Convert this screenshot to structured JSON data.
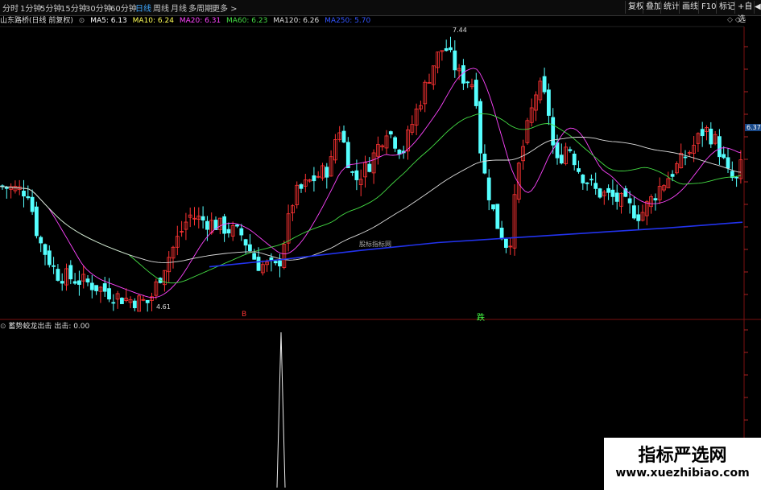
{
  "toolbar": {
    "tabs": [
      "分时",
      "1分钟",
      "5分钟",
      "15分钟",
      "30分钟",
      "60分钟",
      "日线",
      "周线",
      "月线",
      "多周期",
      "更多 >"
    ],
    "active_tab": "日线",
    "right_buttons": [
      "复权",
      "叠加",
      "统计",
      "画线",
      "F10",
      "标记",
      "+自选",
      "◀"
    ]
  },
  "stock": {
    "name": "山东路桥(日线 前复权)"
  },
  "ma_legend": [
    {
      "label": "MA5: 6.13",
      "color": "#ffffff"
    },
    {
      "label": "MA10: 6.24",
      "color": "#ffff55"
    },
    {
      "label": "MA20: 6.31",
      "color": "#ff44ff"
    },
    {
      "label": "MA60: 6.23",
      "color": "#44dd44"
    },
    {
      "label": "MA120: 6.26",
      "color": "#dddddd"
    },
    {
      "label": "MA250: 5.70",
      "color": "#3355ff"
    }
  ],
  "annotations": {
    "high": "7.44",
    "low": "4.61",
    "last_price": "6.37",
    "center_watermark": "股标指标网",
    "buy_marker": "B",
    "sell_marker": "跌"
  },
  "colors": {
    "up": "#ff3333",
    "down": "#55ffff",
    "bg": "#000000"
  },
  "indicator": {
    "name": "蓄势蛟龙出击",
    "legend": "出击: 0.00"
  },
  "watermark": {
    "line1": "指标严选网",
    "line2": "www.xuezhibiao.com"
  },
  "chart_data": {
    "type": "candlestick",
    "price_range": [
      4.61,
      7.44
    ],
    "series": [
      {
        "name": "MA250",
        "values": [
          5.02,
          5.1,
          5.19,
          5.27,
          5.32,
          5.37,
          5.42,
          5.48
        ]
      }
    ],
    "indicator_spike": {
      "values": [
        0,
        1,
        0
      ]
    }
  }
}
